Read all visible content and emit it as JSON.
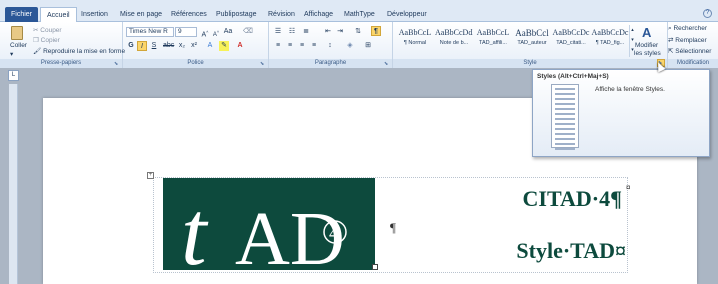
{
  "tabs": [
    "Fichier",
    "Accueil",
    "Insertion",
    "Mise en page",
    "Références",
    "Publipostage",
    "Révision",
    "Affichage",
    "MathType",
    "Développeur"
  ],
  "clipboard": {
    "paste": "Coller",
    "cut": "Couper",
    "copy": "Copier",
    "format_painter": "Reproduire la mise en forme",
    "label": "Presse-papiers"
  },
  "font": {
    "family": "Times New R",
    "size": "9",
    "label": "Police",
    "bold": "G",
    "italic": "I",
    "underline": "S"
  },
  "paragraph": {
    "label": "Paragraphe",
    "pilcrow": "¶"
  },
  "styles": {
    "label": "Style",
    "items": [
      {
        "sample": "AaBbCcL",
        "name": "¶ Normal"
      },
      {
        "sample": "AaBbCcDdI",
        "name": "Note de b..."
      },
      {
        "sample": "AaBbCcL",
        "name": "TAD_affili..."
      },
      {
        "sample": "AaBbCcl",
        "name": "TAD_auteur"
      },
      {
        "sample": "AaBbCcDc",
        "name": "TAD_citati..."
      },
      {
        "sample": "AaBbCcDc",
        "name": "¶ TAD_fig..."
      }
    ],
    "modify_line1": "Modifier",
    "modify_line2": "les styles"
  },
  "editing": {
    "label": "Modification",
    "find": "Rechercher",
    "replace": "Remplacer",
    "select": "Sélectionner"
  },
  "tooltip": {
    "title": "Styles (Alt+Ctrl+Maj+S)",
    "description": "Affiche la fenêtre Styles."
  },
  "document": {
    "logo_t": "t",
    "logo_ad": "AD",
    "logo_num": "4",
    "pilcrow": "¶",
    "heading": "CITAD·4¶",
    "subheading": "Style·TAD¤",
    "cell_mark": "¤"
  },
  "colors": {
    "file_tab": "#2b5797",
    "logo_bg": "#0d4a3d",
    "heading": "#0d4a3d"
  }
}
